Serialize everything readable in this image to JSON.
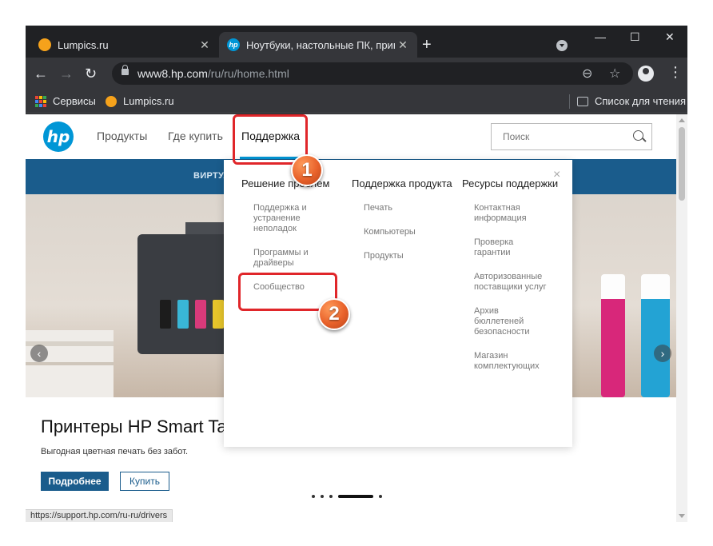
{
  "browser": {
    "tabs": [
      {
        "title": "Lumpics.ru",
        "active": false
      },
      {
        "title": "Ноутбуки, настольные ПК, прин",
        "active": true
      }
    ],
    "new_tab": "+",
    "url_host": "www8.hp.com",
    "url_path": "/ru/ru/home.html",
    "bookmarks": [
      {
        "label": "Сервисы",
        "icon": "apps-grid-icon"
      },
      {
        "label": "Lumpics.ru",
        "icon": "lumpics-favicon"
      }
    ],
    "reading_list": "Список для чтения"
  },
  "hp": {
    "logo": "hp",
    "nav": [
      "Продукты",
      "Где купить",
      "Поддержка"
    ],
    "search_placeholder": "Поиск",
    "blue_bar_text": "ВИРТУА"
  },
  "dropdown": {
    "close": "×",
    "columns": [
      {
        "heading": "Решение проблем",
        "items": [
          "Поддержка и устранение неполадок",
          "Программы и драйверы",
          "Сообщество"
        ]
      },
      {
        "heading": "Поддержка продукта",
        "items": [
          "Печать",
          "Компьютеры",
          "Продукты"
        ]
      },
      {
        "heading": "Ресурсы поддержки",
        "items": [
          "Контактная информация",
          "Проверка гарантии",
          "Авторизованные поставщики услуг",
          "Архив бюллетеней безопасности",
          "Магазин комплектующих"
        ]
      }
    ]
  },
  "hero": {
    "title": "Принтеры HP Smart Ta",
    "subtitle": "Выгодная цветная печать без забот.",
    "primary_button": "Подробнее",
    "secondary_button": "Купить",
    "prev": "‹",
    "next": "›"
  },
  "status_url": "https://support.hp.com/ru-ru/drivers",
  "annotations": {
    "step1": "1",
    "step2": "2"
  },
  "colors": {
    "hp_blue": "#0096d6",
    "hp_dark_blue": "#1a5c8c",
    "highlight_red": "#e0262a",
    "badge_orange": "#e8612a"
  }
}
